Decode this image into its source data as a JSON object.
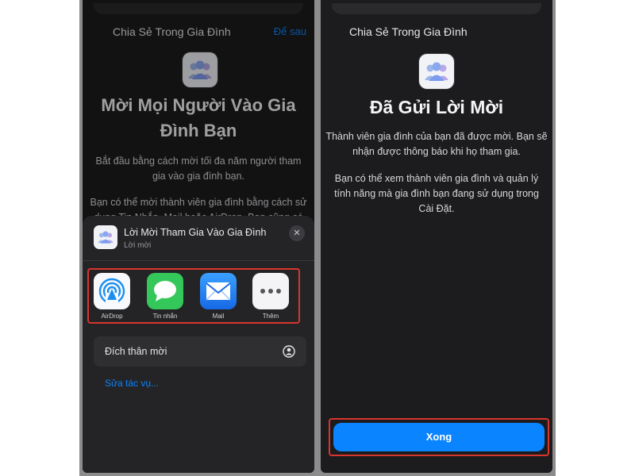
{
  "left": {
    "nav_title": "Chia Sẻ Trong Gia Đình",
    "nav_action": "Để sau",
    "title_line1": "Mời Mọi Người Vào Gia",
    "title_line2": "Đình Bạn",
    "desc_line1": "Bắt đầu bằng cách mời tối đa năm người tham",
    "desc_line2": "gia vào gia đình bạn.",
    "desc2_line1": "Bạn có thể mời thành viên gia đình bằng cách sử",
    "desc2_line2": "dụng Tin Nhắn, Mail hoặc AirDrop. Bạn cũng có",
    "share_sheet": {
      "title": "Lời Mời Tham Gia Vào Gia Đình",
      "subtitle": "Lời mời",
      "close_symbol": "×",
      "apps": [
        {
          "label": "AirDrop",
          "icon": "airdrop-icon"
        },
        {
          "label": "Tin nhắn",
          "icon": "messages-icon"
        },
        {
          "label": "Mail",
          "icon": "mail-icon"
        },
        {
          "label": "Thêm",
          "icon": "more-icon"
        }
      ],
      "action_label": "Đích thân mời",
      "action_icon": "person-share-icon",
      "edit_actions": "Sửa tác vụ..."
    }
  },
  "right": {
    "nav_title": "Chia Sẻ Trong Gia Đình",
    "title": "Đã Gửi Lời Mời",
    "para1_line1": "Thành viên gia đình của bạn đã được mời. Bạn sẽ",
    "para1_line2": "nhận được thông báo khi họ tham gia.",
    "para2_line1": "Bạn có thể xem thành viên gia đình và quản lý",
    "para2_line2": "tính năng mà gia đình bạn đang sử dụng trong",
    "para2_line3": "Cài Đặt.",
    "done_button": "Xong"
  },
  "colors": {
    "accent": "#0a84ff",
    "highlight": "#d8352f",
    "background": "#1c1c1e"
  }
}
